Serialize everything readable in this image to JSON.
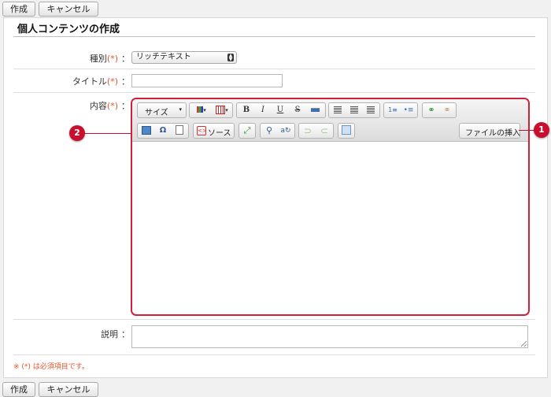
{
  "top_actions": {
    "create": "作成",
    "cancel": "キャンセル"
  },
  "bottom_actions": {
    "create": "作成",
    "cancel": "キャンセル"
  },
  "page": {
    "title": "個人コンテンツの作成"
  },
  "form": {
    "type": {
      "label": "種別",
      "required": "(*)",
      "colon": "：",
      "value": "リッチテキスト"
    },
    "title": {
      "label": "タイトル",
      "required": "(*)",
      "colon": "：",
      "value": ""
    },
    "content": {
      "label": "内容",
      "required": "(*)",
      "colon": "："
    },
    "description": {
      "label": "説明",
      "colon": "："
    }
  },
  "editor": {
    "size_label": "サイズ",
    "source_label": "ソース",
    "insert_file_label": "ファイルの挿入",
    "bold": "B",
    "italic": "I",
    "underline": "U",
    "strike": "S"
  },
  "callouts": {
    "one": "1",
    "two": "2"
  },
  "footer_note": "※ (*) は必須項目です。",
  "colors": {
    "required": "#e2532b",
    "callout": "#c8102e",
    "highlight_border": "#d2203a"
  }
}
